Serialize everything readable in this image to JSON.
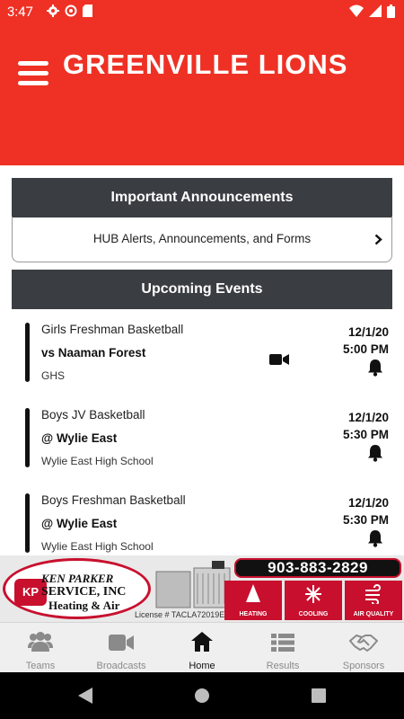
{
  "status_bar": {
    "time": "3:47",
    "left_icons": [
      "settings-icon",
      "at-sign-icon",
      "sd-card-icon"
    ],
    "right_icons": [
      "wifi-icon",
      "signal-icon",
      "battery-icon"
    ]
  },
  "header": {
    "title": "GREENVILLE LIONS",
    "background_color": "#ee3124",
    "menu_icon": "hamburger-menu-icon"
  },
  "announcements": {
    "heading": "Important Announcements",
    "link_label": "HUB Alerts, Announcements, and Forms",
    "chevron_icon": "chevron-right-icon"
  },
  "events": {
    "heading": "Upcoming Events",
    "items": [
      {
        "sport": "Girls Freshman Basketball",
        "opponent_prefix": "vs",
        "opponent": "Naaman Forest",
        "location": "GHS",
        "date": "12/1/20",
        "time": "5:00 PM",
        "has_video": true
      },
      {
        "sport": "Boys JV Basketball",
        "opponent_prefix": "@",
        "opponent": "Wylie East",
        "location": "Wylie East High School",
        "date": "12/1/20",
        "time": "5:30 PM",
        "has_video": false
      },
      {
        "sport": "Boys Freshman Basketball",
        "opponent_prefix": "@",
        "opponent": "Wylie East",
        "location": "Wylie East High School",
        "date": "12/1/20",
        "time": "5:30 PM",
        "has_video": false
      }
    ]
  },
  "ad": {
    "logo_initials": "KP",
    "name_line1": "KEN PARKER",
    "name_line2": "SERVICE, INC",
    "name_line3": "Heating & Air",
    "license": "License # TACLA72019E",
    "phone": "903-883-2829",
    "tiles": [
      "HEATING",
      "COOLING",
      "AIR QUALITY"
    ]
  },
  "tabs": [
    {
      "label": "Teams",
      "icon": "teams-icon",
      "active": false
    },
    {
      "label": "Broadcasts",
      "icon": "video-camera-icon",
      "active": false
    },
    {
      "label": "Home",
      "icon": "home-icon",
      "active": true
    },
    {
      "label": "Results",
      "icon": "list-icon",
      "active": false
    },
    {
      "label": "Sponsors",
      "icon": "handshake-icon",
      "active": false
    }
  ],
  "nav_bar": [
    "back-icon",
    "home-circle-icon",
    "recents-icon"
  ]
}
